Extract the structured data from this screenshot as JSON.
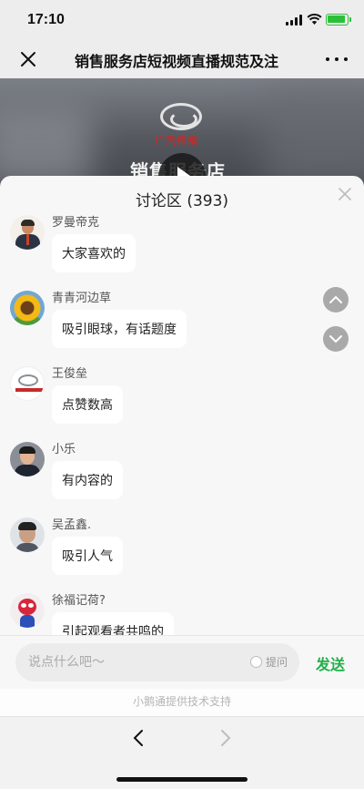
{
  "status_bar": {
    "time": "17:10"
  },
  "nav": {
    "title": "销售服务店短视频直播规范及注",
    "close_icon": "close-icon",
    "more_icon": "more-icon"
  },
  "video": {
    "brand_text": "广汽传祺",
    "caption": "销售服务店"
  },
  "discussion": {
    "title": "讨论区 (393)",
    "comments": [
      {
        "name": "罗曼帝克",
        "text": "大家喜欢的"
      },
      {
        "name": "青青河边草",
        "text": "吸引眼球，有话题度"
      },
      {
        "name": "王俊垒",
        "text": "点赞数高"
      },
      {
        "name": "小乐",
        "text": "有内容的"
      },
      {
        "name": "吴孟鑫.",
        "text": "吸引人气"
      },
      {
        "name": "徐福记荷?",
        "text": "引起观看者共鸣的"
      }
    ]
  },
  "input": {
    "placeholder": "说点什么吧～",
    "question_label": "提问",
    "send_label": "发送"
  },
  "footer": {
    "powered_by": "小鹅通提供技术支持"
  },
  "colors": {
    "accent": "#22b04a",
    "background": "#ededed",
    "sheet": "#f7f7f7"
  }
}
